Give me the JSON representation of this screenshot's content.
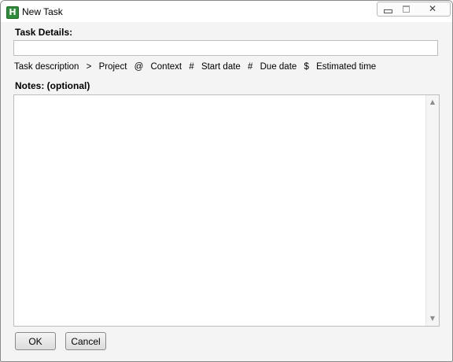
{
  "window": {
    "title": "New Task",
    "app_icon_glyph": "H",
    "close_glyph": "✕"
  },
  "task_details": {
    "label": "Task Details:",
    "value": "",
    "placeholder": ""
  },
  "syntax_hint": {
    "parts": [
      "Task description",
      ">",
      "Project",
      "@",
      "Context",
      "#",
      "Start date",
      "#",
      "Due date",
      "$",
      "Estimated time"
    ]
  },
  "notes": {
    "label": "Notes:  (optional)",
    "value": ""
  },
  "scroll": {
    "up_glyph": "▲",
    "down_glyph": "▼"
  },
  "buttons": {
    "ok_label": "OK",
    "cancel_label": "Cancel"
  },
  "colors": {
    "app_icon": "#2e8b3a",
    "window_bg": "#f4f4f4"
  }
}
